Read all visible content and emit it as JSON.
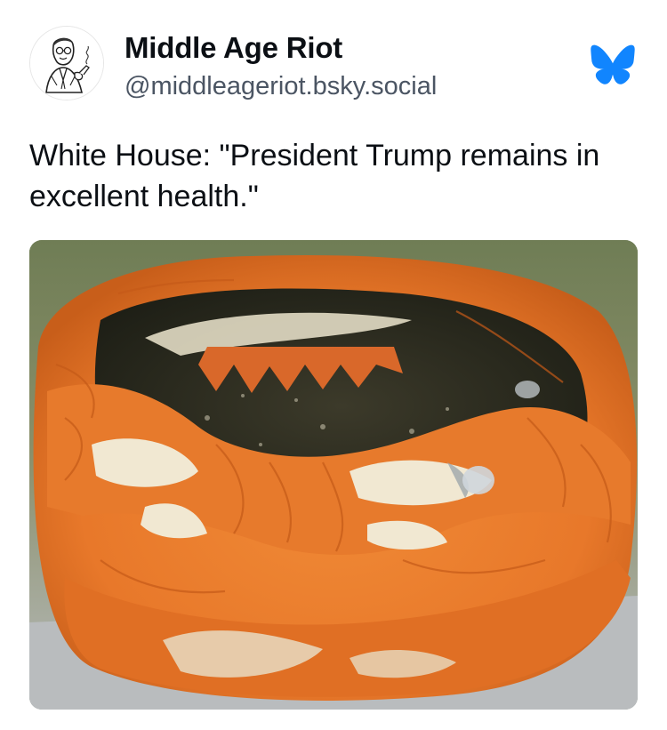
{
  "post": {
    "author": {
      "display_name": "Middle Age Riot",
      "handle": "@middleageriot.bsky.social",
      "avatar_icon": "vintage-man-with-pipe-illustration"
    },
    "platform_icon": "bluesky-butterfly-icon",
    "platform_color": "#1185fe",
    "text": "White House: \"President Trump remains in excellent health.\"",
    "image": {
      "description_icon": "rotting-jack-o-lantern-photo",
      "accent_color": "#e8782a"
    }
  }
}
